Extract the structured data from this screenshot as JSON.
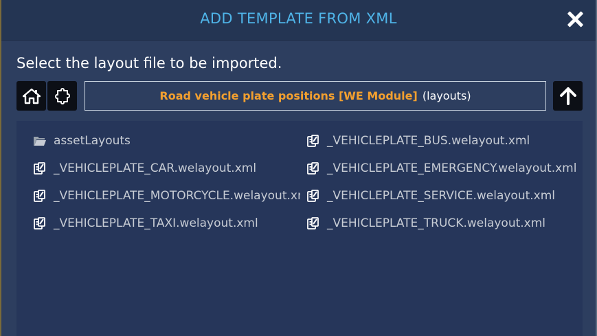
{
  "dialog": {
    "title": "ADD TEMPLATE FROM XML",
    "instruction": "Select the layout file to be imported."
  },
  "toolbar": {
    "home_icon": "home-icon",
    "mod_icon": "puzzle-piece-icon",
    "up_icon": "arrow-up-icon",
    "path_name": "Road vehicle plate positions [WE Module]",
    "path_suffix": "(layouts)"
  },
  "files": {
    "left": [
      {
        "label": "assetLayouts",
        "icon": "folder-icon"
      },
      {
        "label": "_VEHICLEPLATE_CAR.welayout.xml",
        "icon": "document-icon"
      },
      {
        "label": "_VEHICLEPLATE_MOTORCYCLE.welayout.xml",
        "icon": "document-icon"
      },
      {
        "label": "_VEHICLEPLATE_TAXI.welayout.xml",
        "icon": "document-icon"
      }
    ],
    "right": [
      {
        "label": "_VEHICLEPLATE_BUS.welayout.xml",
        "icon": "document-icon"
      },
      {
        "label": "_VEHICLEPLATE_EMERGENCY.welayout.xml",
        "icon": "document-icon"
      },
      {
        "label": "_VEHICLEPLATE_SERVICE.welayout.xml",
        "icon": "document-icon"
      },
      {
        "label": "_VEHICLEPLATE_TRUCK.welayout.xml",
        "icon": "document-icon"
      }
    ]
  },
  "colors": {
    "title": "#4fb4e8",
    "path_highlight": "#f3a02f",
    "panel": "#2d3e5f"
  }
}
